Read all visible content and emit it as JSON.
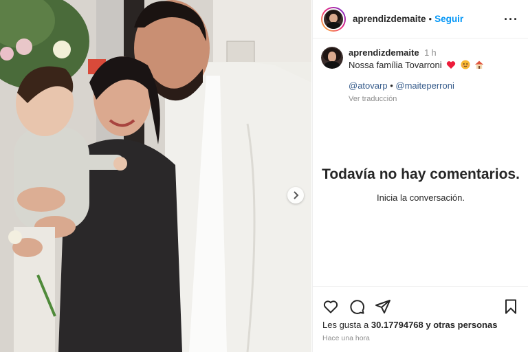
{
  "post": {
    "username": "aprendizdemaite",
    "separator": "•",
    "follow_label": "Seguir",
    "more_label": "···"
  },
  "caption": {
    "username": "aprendizdemaite",
    "time": "1 h",
    "text": "Nossa família Tovarroni",
    "emojis": [
      "red-heart-icon",
      "smiling-face-icon",
      "house-icon"
    ],
    "mention_1": "@atovarp",
    "mention_sep": "•",
    "mention_2": "@maiteperroni",
    "translate_label": "Ver traducción"
  },
  "empty_comments": {
    "title": "Todavía no hay comentarios.",
    "subtitle": "Inicia la conversación."
  },
  "actions": {
    "likes_prefix": "Les gusta a",
    "likes_user": "30.17794768",
    "likes_suffix": "y otras personas",
    "time_ago": "Hace una hora"
  },
  "icons": {
    "like": "heart-icon",
    "comment": "comment-icon",
    "share": "paper-plane-icon",
    "save": "bookmark-icon",
    "next": "chevron-right-icon"
  },
  "colors": {
    "link": "#0095f6",
    "mention": "#385d8c",
    "muted": "#8e8e8e",
    "heart": "#ed1c3a"
  }
}
